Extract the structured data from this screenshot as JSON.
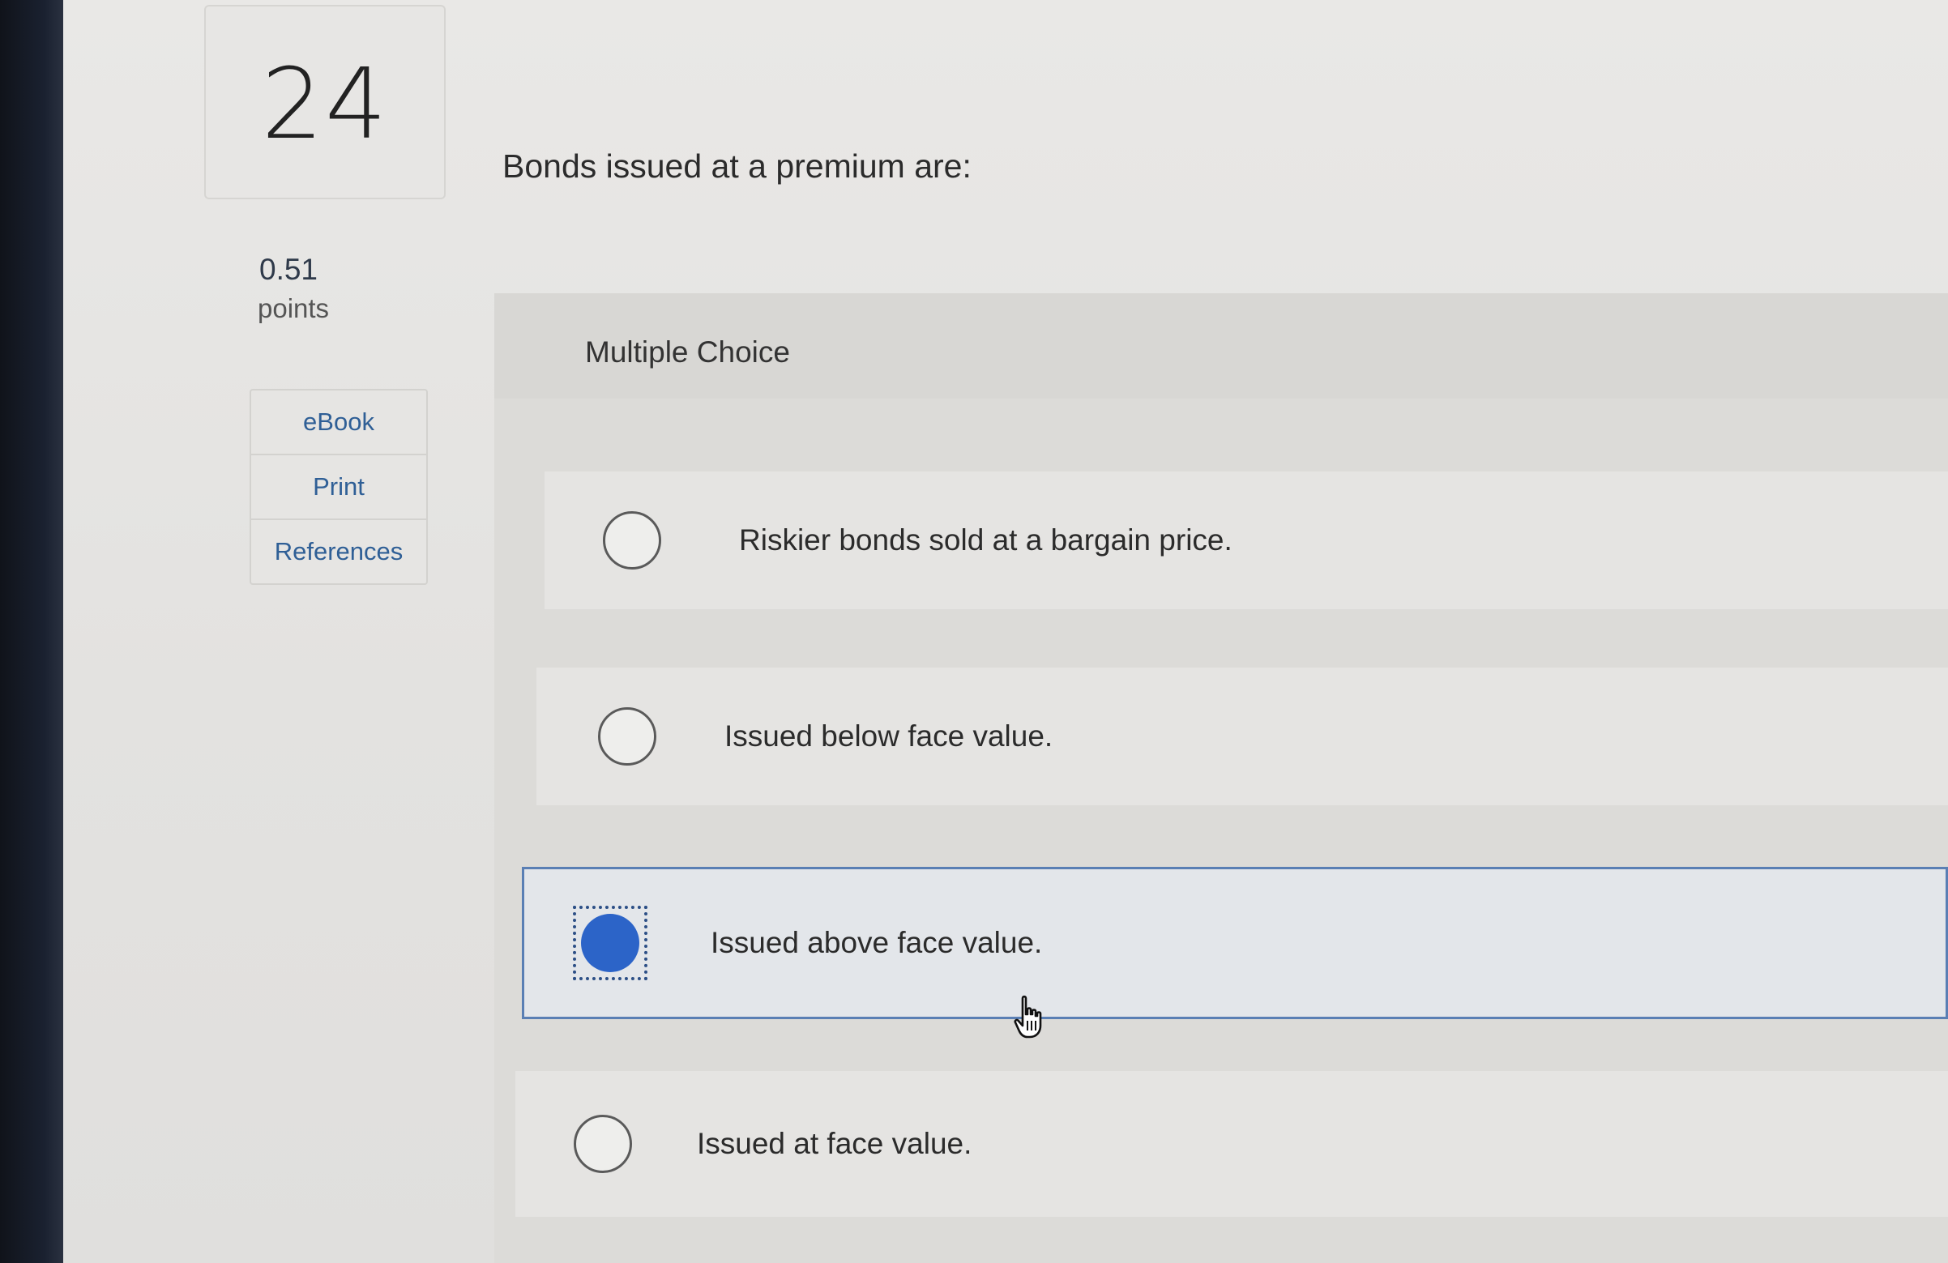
{
  "question": {
    "number": "24",
    "points_value": "0.51",
    "points_label": "points",
    "text": "Bonds issued at a premium are:"
  },
  "side_tools": [
    {
      "label": "eBook"
    },
    {
      "label": "Print"
    },
    {
      "label": "References"
    }
  ],
  "answer_panel": {
    "header": "Multiple Choice",
    "options": [
      {
        "label": "Riskier bonds sold at a bargain price.",
        "selected": false
      },
      {
        "label": "Issued below face value.",
        "selected": false
      },
      {
        "label": "Issued above face value.",
        "selected": true
      },
      {
        "label": "Issued at face value.",
        "selected": false
      }
    ]
  },
  "colors": {
    "accent_blue": "#2c64c8",
    "link_blue": "#2f5f96",
    "selected_border": "#5a7fb4"
  },
  "icons": {
    "cursor": "hand-pointer-icon"
  }
}
